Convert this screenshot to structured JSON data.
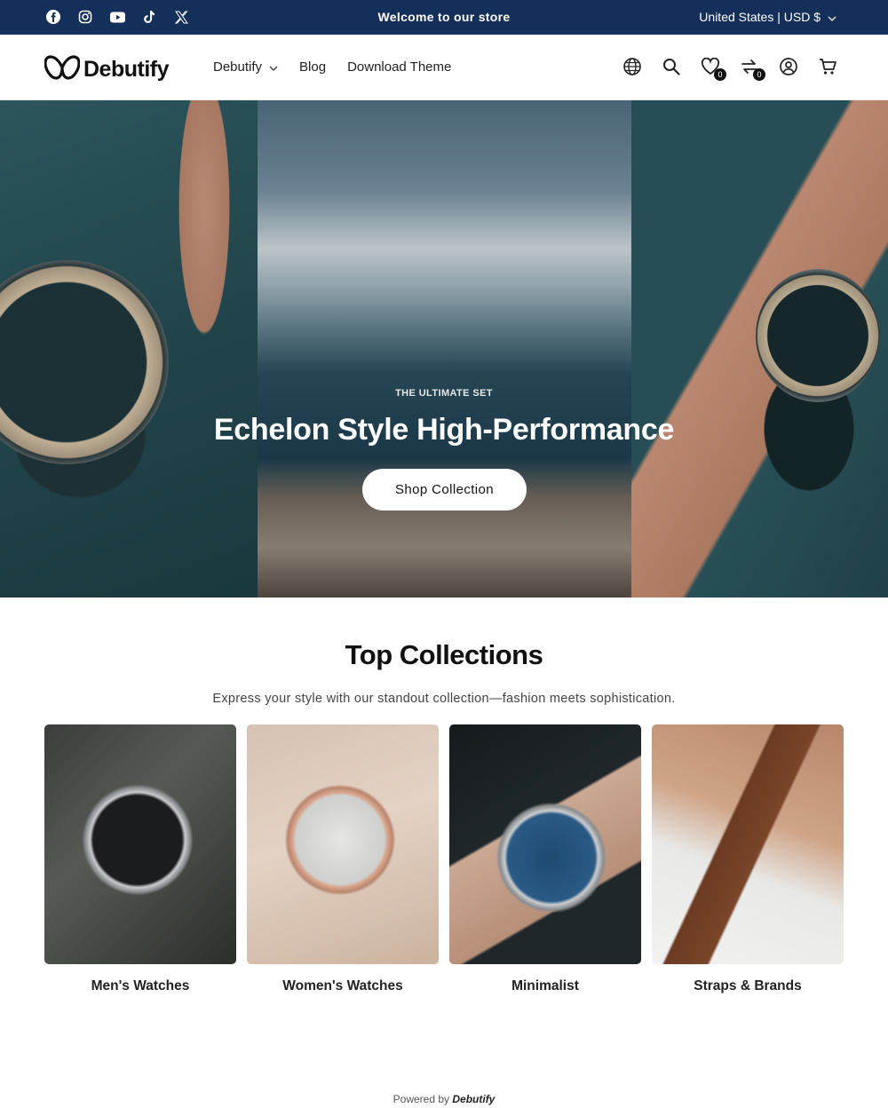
{
  "announcement": {
    "social": [
      "facebook-icon",
      "instagram-icon",
      "youtube-icon",
      "tiktok-icon",
      "x-icon"
    ],
    "message": "Welcome to our store",
    "locale": "United States | USD $"
  },
  "header": {
    "logo": "Debutify",
    "nav": [
      {
        "label": "Debutify",
        "has_dropdown": true
      },
      {
        "label": "Blog",
        "has_dropdown": false
      },
      {
        "label": "Download Theme",
        "has_dropdown": false
      }
    ],
    "icons": [
      "globe-icon",
      "search-icon",
      "wishlist-icon",
      "compare-icon",
      "account-icon",
      "cart-icon"
    ],
    "wishlist_count": "0",
    "compare_count": "0"
  },
  "hero": {
    "eyebrow": "THE ULTIMATE SET",
    "title": "Echelon Style High-Performance",
    "button": "Shop Collection"
  },
  "collections": {
    "title": "Top Collections",
    "subtitle": "Express your style with our standout collection—fashion meets sophistication.",
    "items": [
      {
        "label": "Men's Watches"
      },
      {
        "label": "Women's Watches"
      },
      {
        "label": "Minimalist"
      },
      {
        "label": "Straps & Brands"
      }
    ]
  },
  "footer": {
    "powered_prefix": "Powered by",
    "powered_brand": "Debutify"
  },
  "colors": {
    "announcement_bg": "#14305a",
    "text_dark": "#111111",
    "button_bg": "#ffffff"
  }
}
